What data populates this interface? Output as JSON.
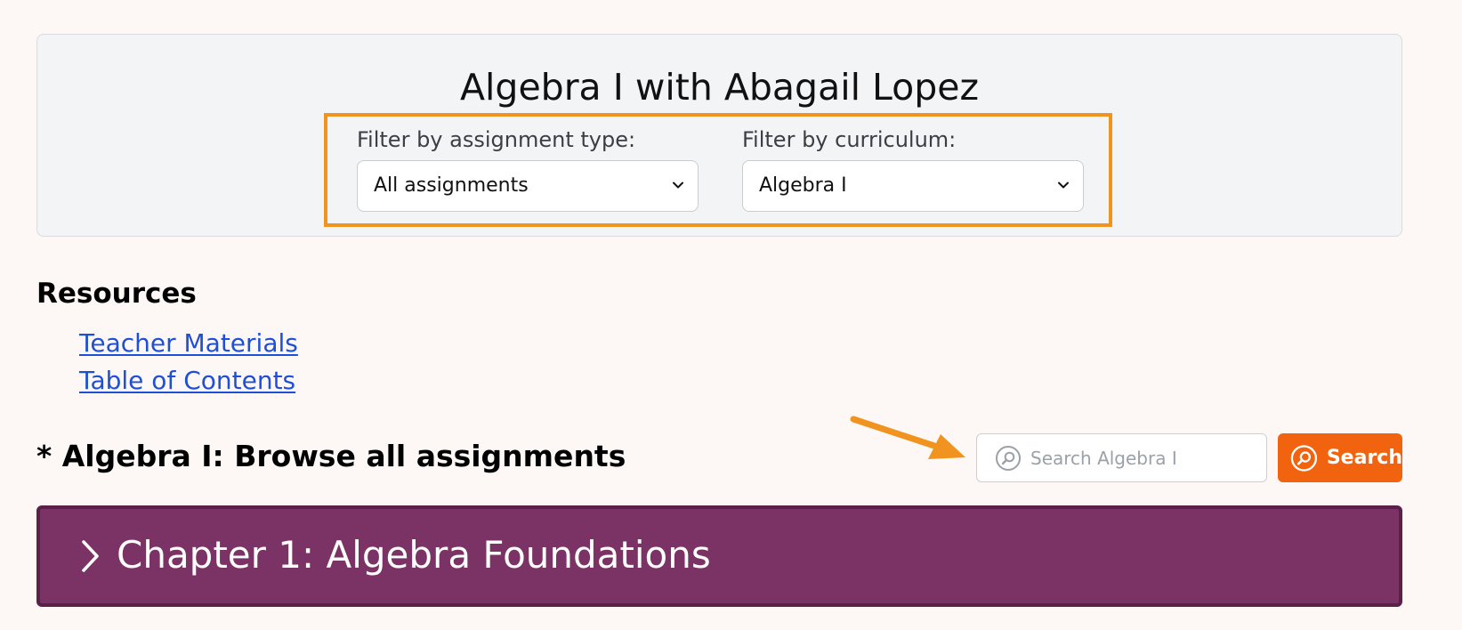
{
  "header": {
    "title": "Algebra I with Abagail Lopez",
    "filters": {
      "assignment_type": {
        "label": "Filter by assignment type:",
        "selected": "All assignments"
      },
      "curriculum": {
        "label": "Filter by curriculum:",
        "selected": "Algebra I"
      }
    }
  },
  "resources": {
    "heading": "Resources",
    "links": [
      "Teacher Materials",
      "Table of Contents"
    ]
  },
  "browse": {
    "heading": "* Algebra I: Browse all assignments",
    "search": {
      "placeholder": "Search Algebra I",
      "button_label": "Search"
    }
  },
  "chapters": [
    {
      "title": "Chapter 1: Algebra Foundations"
    }
  ],
  "colors": {
    "page_bg": "#fdf8f6",
    "highlight_orange": "#f0941f",
    "search_button": "#f1630f",
    "chapter_bar": "#7b3265",
    "link": "#1e4fd8"
  },
  "icons": {
    "select_chevron": "chevron-down-icon",
    "search": "search-icon",
    "chapter_toggle": "chevron-right-icon",
    "annotation": "arrow-annotation"
  }
}
